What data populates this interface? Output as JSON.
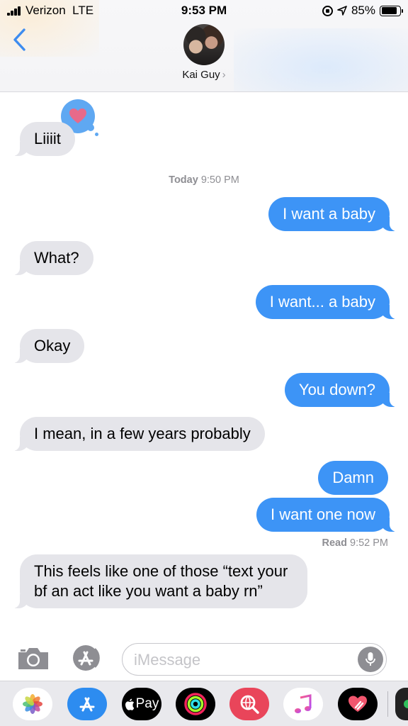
{
  "status_bar": {
    "carrier": "Verizon",
    "network": "LTE",
    "time": "9:53 PM",
    "battery": "85%",
    "battery_level": 0.85
  },
  "header": {
    "contact_name": "Kai Guy",
    "chevron": "›",
    "back_icon": "chevron-left-icon"
  },
  "messages": [
    {
      "dir": "in",
      "text": "Liiiit",
      "tapback": "heart-icon"
    },
    {
      "dir": "out",
      "text": "I want a baby"
    },
    {
      "dir": "in",
      "text": "What?"
    },
    {
      "dir": "out",
      "text": "I want... a baby"
    },
    {
      "dir": "in",
      "text": "Okay"
    },
    {
      "dir": "out",
      "text": "You down?"
    },
    {
      "dir": "in",
      "text": "I mean, in a few years probably"
    },
    {
      "dir": "out",
      "text": "Damn"
    },
    {
      "dir": "out",
      "text": "I want one now"
    },
    {
      "dir": "in",
      "text": "This feels like one of those “text your bf an act like you want a baby rn”"
    }
  ],
  "timestamp": {
    "day": "Today",
    "time": "9:50 PM"
  },
  "read_receipt": {
    "label": "Read",
    "time": "9:52 PM"
  },
  "input": {
    "placeholder": "iMessage"
  },
  "app_drawer": {
    "apple_pay_label": "Pay",
    "apps": [
      "photos-icon",
      "app-store-icon",
      "apple-pay-icon",
      "activity-icon",
      "web-images-icon",
      "music-icon",
      "digital-touch-icon",
      "more-app-icon"
    ]
  },
  "colors": {
    "outgoing_bubble": "#3d94f6",
    "incoming_bubble": "#e5e5ea",
    "heart": "#e86a8a",
    "tapback_bubble": "#5fa8f2"
  }
}
